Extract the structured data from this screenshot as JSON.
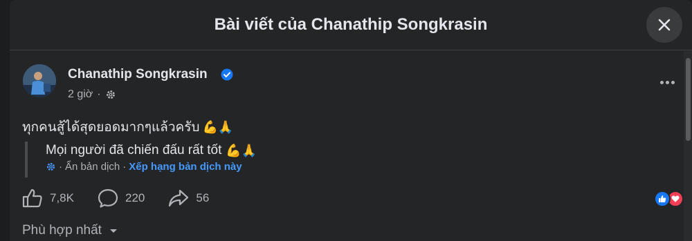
{
  "dialog": {
    "title": "Bài viết của Chanathip Songkrasin"
  },
  "post": {
    "author": "Chanathip Songkrasin",
    "time": "2 giờ",
    "text": "ทุกคนสู้ได้สุดยอดมากๆแล้วครับ",
    "emojis": "💪🙏",
    "translation": {
      "text": "Mọi người đã chiến đấu rất tốt",
      "hide_label": "Ẩn bản dịch",
      "rate_label": "Xếp hạng bản dịch này",
      "separator": "·"
    },
    "stats": {
      "likes": "7,8K",
      "comments": "220",
      "shares": "56"
    }
  },
  "comments": {
    "filter_label": "Phù hợp nhất"
  },
  "icons": {
    "close": "close-icon",
    "verified": "verified-badge-icon",
    "privacy": "gear-icon",
    "more": "more-icon",
    "like": "thumbs-up-icon",
    "comment": "comment-icon",
    "share": "share-icon",
    "reaction_like": "like-reaction-icon",
    "reaction_love": "love-reaction-icon",
    "dropdown": "caret-down-icon"
  },
  "colors": {
    "background": "#242526",
    "text": "#e4e6eb",
    "secondary": "#b0b3b8",
    "link": "#4599ff",
    "verified": "#1877f2",
    "love": "#f33e58"
  }
}
